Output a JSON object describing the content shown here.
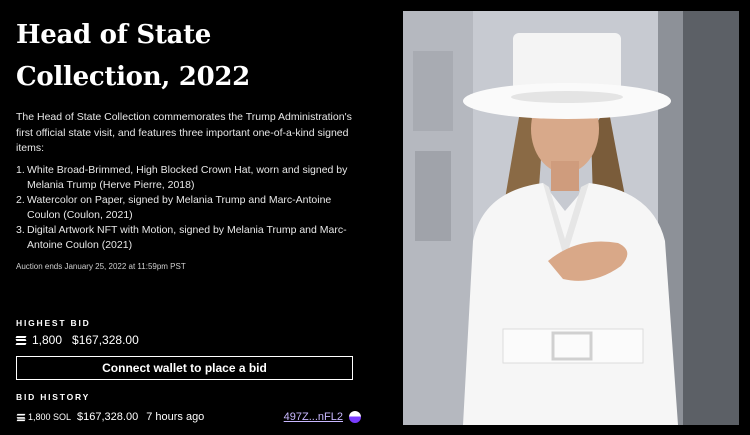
{
  "header": {
    "title": "Head of State Collection, 2022"
  },
  "description": "The Head of State Collection commemorates the Trump Administration's first official state visit, and features three important one-of-a-kind signed items:",
  "items": [
    {
      "num": "1.",
      "text": "White Broad-Brimmed, High Blocked Crown Hat, worn and signed by Melania Trump (Herve Pierre, 2018)"
    },
    {
      "num": "2.",
      "text": "Watercolor on Paper, signed by Melania Trump and Marc-Antoine Coulon (Coulon, 2021)"
    },
    {
      "num": "3.",
      "text": "Digital Artwork NFT with Motion, signed by Melania Trump and Marc-Antoine Coulon (2021)"
    }
  ],
  "auction_end": "Auction ends January 25, 2022 at 11:59pm PST",
  "highest_bid": {
    "label": "HIGHEST BID",
    "sol": "1,800",
    "usd": "$167,328.00"
  },
  "connect_button": "Connect wallet to place a bid",
  "bid_history": {
    "label": "BID HISTORY",
    "rows": [
      {
        "sol": "1,800 SOL",
        "usd": "$167,328.00",
        "time": "7 hours ago",
        "address": "497Z...nFL2"
      }
    ]
  },
  "colors": {
    "background": "#000000",
    "text": "#ffffff",
    "address_link": "#c9b8ff",
    "avatar_accent": "#7a3cff"
  },
  "icons": [
    "solana-icon",
    "wallet-avatar-icon"
  ],
  "image": {
    "subject": "photo"
  }
}
